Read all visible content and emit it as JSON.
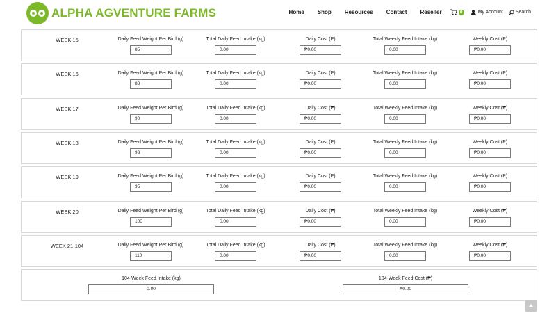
{
  "brand": {
    "name": "ALPHA AGVENTURE FARMS",
    "color": "#7cb928"
  },
  "nav": {
    "links": [
      "Home",
      "Shop",
      "Resources",
      "Contact",
      "Reseller"
    ],
    "cart_count": "0",
    "account": "My Account",
    "search": "Search"
  },
  "columns": {
    "daily_weight": "Daily Feed Weight Per Bird (g)",
    "total_daily": "Total Daily Feed Intake (kg)",
    "daily_cost": "Daily Cost (₱)",
    "total_weekly": "Total Weekly Feed Intake (kg)",
    "weekly_cost": "Weekly Cost (₱)"
  },
  "weeks": [
    {
      "label": "WEEK 15",
      "daily_weight": "85",
      "total_daily": "0.00",
      "daily_cost": "₱0.00",
      "total_weekly": "0.00",
      "weekly_cost": "₱0.00"
    },
    {
      "label": "WEEK 16",
      "daily_weight": "88",
      "total_daily": "0.00",
      "daily_cost": "₱0.00",
      "total_weekly": "0.00",
      "weekly_cost": "₱0.00"
    },
    {
      "label": "WEEK 17",
      "daily_weight": "90",
      "total_daily": "0.00",
      "daily_cost": "₱0.00",
      "total_weekly": "0.00",
      "weekly_cost": "₱0.00"
    },
    {
      "label": "WEEK 18",
      "daily_weight": "93",
      "total_daily": "0.00",
      "daily_cost": "₱0.00",
      "total_weekly": "0.00",
      "weekly_cost": "₱0.00"
    },
    {
      "label": "WEEK 19",
      "daily_weight": "95",
      "total_daily": "0.00",
      "daily_cost": "₱0.00",
      "total_weekly": "0.00",
      "weekly_cost": "₱0.00"
    },
    {
      "label": "WEEK 20",
      "daily_weight": "100",
      "total_daily": "0.00",
      "daily_cost": "₱0.00",
      "total_weekly": "0.00",
      "weekly_cost": "₱0.00"
    },
    {
      "label": "WEEK 21-104",
      "daily_weight": "110",
      "total_daily": "0.00",
      "daily_cost": "₱0.00",
      "total_weekly": "0.00",
      "weekly_cost": "₱0.00"
    }
  ],
  "summary": {
    "intake_label": "104-Week Feed Intake (kg)",
    "intake_value": "0.00",
    "cost_label": "104-Week Feed Cost (₱)",
    "cost_value": "₱0.00"
  }
}
